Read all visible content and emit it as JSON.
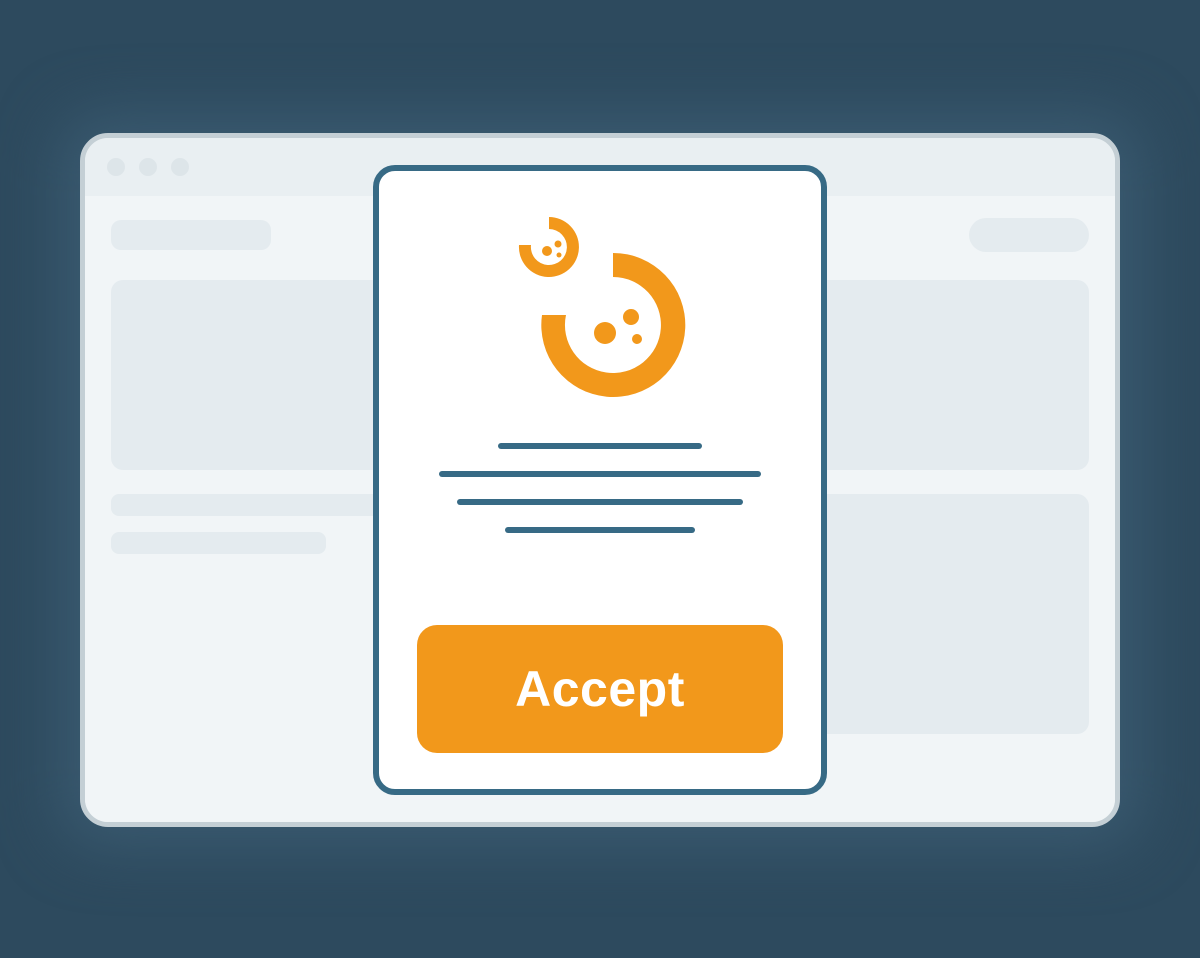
{
  "modal": {
    "accept_label": "Accept"
  },
  "colors": {
    "accent": "#f2981b",
    "frame": "#376a85",
    "background": "#2d4a5e"
  }
}
